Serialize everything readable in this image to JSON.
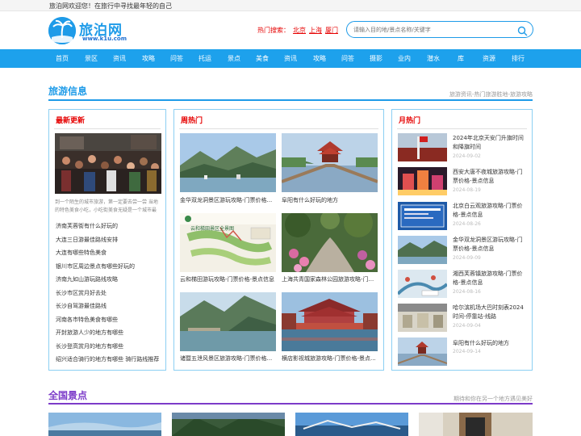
{
  "topbar": {
    "welcome": "旅泊网欢迎您！在旅行中寻找最年轻的自己"
  },
  "logo": {
    "text": "旅泊网",
    "url": "www.k1u.com"
  },
  "hot_search": {
    "label": "热门搜索：",
    "links": [
      "北京",
      "上海",
      "厦门"
    ]
  },
  "search": {
    "placeholder": "请输入目的地/景点名称/关键字"
  },
  "nav": [
    "首页",
    "景区",
    "资讯",
    "攻略",
    "问答",
    "托运",
    "景点",
    "美食",
    "资讯",
    "攻略",
    "问答",
    "摄影",
    "业内",
    "潜水",
    "库",
    "资源",
    "排行"
  ],
  "section1": {
    "title": "旅游信息",
    "subtitle": "旅游资讯-热门旅游胜地-旅游攻略"
  },
  "latest": {
    "title": "最新更新",
    "summary_line1": "到一个陌生的城市旅游，第一定要去尝一尝 当地",
    "summary_line2": "的特色美食小吃，小吃街美食无疑是一个城市最",
    "items": [
      "济南芙蓉街有什么好玩的",
      "大连三日游最佳路线安排",
      "大连有哪些特色美食",
      "银川市区周边景点有哪些好玩的",
      "济南九如山游玩路线攻略",
      "长沙市区赏月好去处",
      "长沙自驾游最佳路线",
      "河南各市特色美食有哪些",
      "开封旅游人少的地方有哪些",
      "长沙登高赏月的地方有哪些",
      "绍兴适合骑行的地方有哪些 骑行路线推荐"
    ]
  },
  "weekly": {
    "title": "周热门",
    "items": [
      "金华双龙洞景区游玩攻略-门票价格...",
      "阜阳有什么好玩的地方",
      "云和梯田游玩攻略-门票价格-景点信息",
      "上海共青国家森林公园旅游攻略-门...",
      "诸暨五泄风景区旅游攻略-门票价格...",
      "横店影视城旅游攻略-门票价格-景点..."
    ],
    "map_label": "云和梯田景区全景图"
  },
  "monthly": {
    "title": "月热门",
    "items": [
      {
        "title": "2024年北京天安门升旗时间和降旗时间",
        "date": "2024-09-02"
      },
      {
        "title": "西安大唐不夜城旅游攻略-门票价格-景点信息",
        "date": "2024-08-19"
      },
      {
        "title": "北京白云观旅游攻略-门票价格-景点信息",
        "date": "2024-08-26"
      },
      {
        "title": "金华双龙洞景区游玩攻略-门票价格-景点信息",
        "date": "2024-09-09"
      },
      {
        "title": "湘西芙蓉镇旅游攻略-门票价格-景点信息",
        "date": "2024-08-16"
      },
      {
        "title": "哈尔滨机场大巴时刻表2024时间-停靠站-线路",
        "date": "2024-09-04"
      },
      {
        "title": "阜阳有什么好玩的地方",
        "date": "2024-09-14"
      }
    ]
  },
  "section2": {
    "title": "全国景点",
    "subtitle": "期待和你在另一个地方遇见美好"
  },
  "colors": {
    "accent": "#1e9be8",
    "nav_bg": "#1da1ec",
    "hot_red": "#e60000",
    "section2": "#7c3bc9"
  }
}
